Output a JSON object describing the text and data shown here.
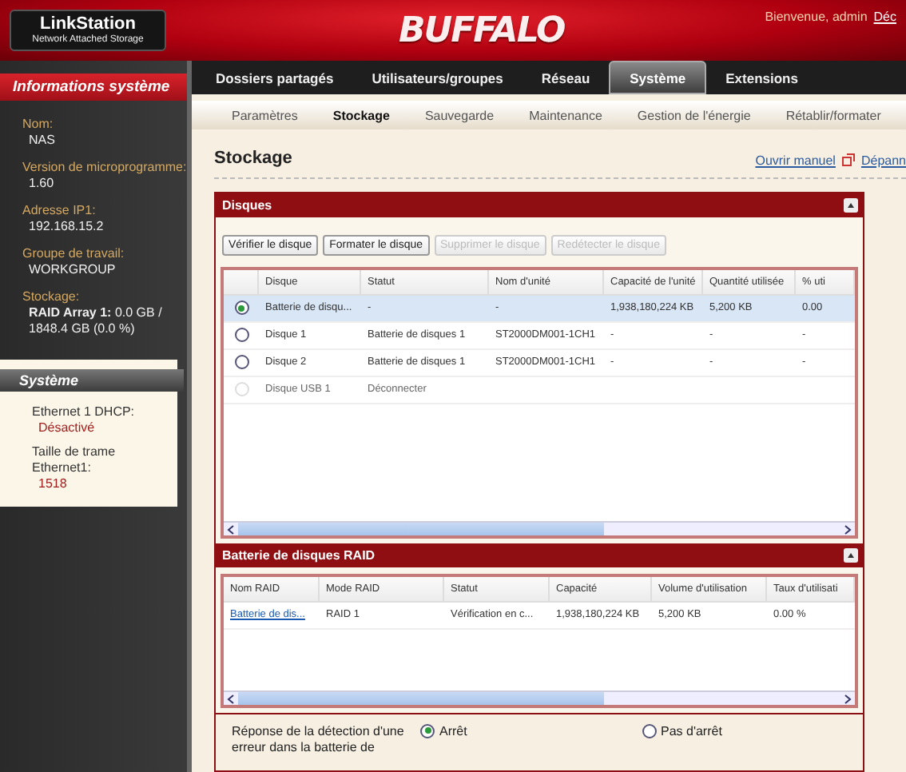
{
  "header": {
    "product": "LinkStation",
    "product_sub": "Network Attached Storage",
    "brand": "BUFFALO",
    "welcome": "Bienvenue, admin",
    "logout": "Déc"
  },
  "sidebar": {
    "title": "Informations système",
    "items": [
      {
        "label": "Nom:",
        "value": "NAS"
      },
      {
        "label": "Version de microprogramme:",
        "value": "1.60"
      },
      {
        "label": "Adresse IP1:",
        "value": "192.168.15.2"
      },
      {
        "label": "Groupe de travail:",
        "value": "WORKGROUP"
      },
      {
        "label": "Stockage:",
        "value": "**RAID Array 1:** 0.0 GB / 1848.4 GB (0.0 %)"
      }
    ],
    "system": {
      "title": "Système",
      "items": [
        {
          "label": "Ethernet 1 DHCP:",
          "value": "Désactivé"
        },
        {
          "label": "Taille de trame Ethernet1:",
          "value": "1518"
        }
      ]
    }
  },
  "nav": [
    {
      "label": "Dossiers partagés",
      "selected": false
    },
    {
      "label": "Utilisateurs/groupes",
      "selected": false
    },
    {
      "label": "Réseau",
      "selected": false
    },
    {
      "label": "Système",
      "selected": true
    },
    {
      "label": "Extensions",
      "selected": false
    }
  ],
  "subnav": [
    {
      "label": "Paramètres",
      "selected": false
    },
    {
      "label": "Stockage",
      "selected": true
    },
    {
      "label": "Sauvegarde",
      "selected": false
    },
    {
      "label": "Maintenance",
      "selected": false
    },
    {
      "label": "Gestion de l'énergie",
      "selected": false
    },
    {
      "label": "Rétablir/formater",
      "selected": false
    }
  ],
  "page_title": "Stockage",
  "links": [
    "Ouvrir manuel",
    "Dépann"
  ],
  "disks": {
    "title": "Disques",
    "buttons": [
      {
        "label": "Vérifier le disque",
        "disabled": false
      },
      {
        "label": "Formater le disque",
        "disabled": false
      },
      {
        "label": "Supprimer le disque",
        "disabled": true
      },
      {
        "label": "Redétecter le disque",
        "disabled": true
      }
    ],
    "columns": [
      "Disque",
      "Statut",
      "Nom d'unité",
      "Capacité de l'unité",
      "Quantité utilisée",
      "% uti"
    ],
    "rows": [
      {
        "selected": true,
        "disabled": false,
        "cells": [
          "Batterie de disqu...",
          "-",
          "-",
          "1,938,180,224 KB",
          "5,200 KB",
          "0.00"
        ]
      },
      {
        "selected": false,
        "disabled": false,
        "cells": [
          "Disque 1",
          "Batterie de disques 1",
          "ST2000DM001-1CH1",
          "-",
          "-",
          "-"
        ]
      },
      {
        "selected": false,
        "disabled": false,
        "cells": [
          "Disque 2",
          "Batterie de disques 1",
          "ST2000DM001-1CH1",
          "-",
          "-",
          "-"
        ]
      },
      {
        "selected": false,
        "disabled": true,
        "cells": [
          "Disque USB 1",
          "Déconnecter",
          "",
          "",
          "",
          ""
        ]
      }
    ]
  },
  "raid": {
    "title": "Batterie de disques RAID",
    "columns": [
      "Nom RAID",
      "Mode RAID",
      "Statut",
      "Capacité",
      "Volume d'utilisation",
      "Taux d'utilisati"
    ],
    "rows": [
      {
        "cells": [
          "Batterie de dis...",
          "RAID 1",
          "Vérification en c...",
          "1,938,180,224 KB",
          "5,200 KB",
          "0.00 %"
        ]
      }
    ]
  },
  "error_response": {
    "label": "Réponse de la détection d'une erreur dans la batterie de",
    "options": [
      {
        "label": "Arrêt",
        "selected": true
      },
      {
        "label": "Pas d'arrêt",
        "selected": false
      }
    ]
  }
}
